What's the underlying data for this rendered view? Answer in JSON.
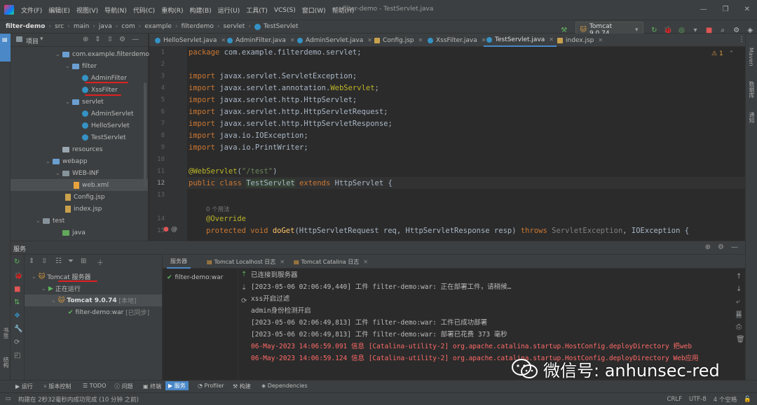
{
  "window": {
    "title": "filter-demo - TestServlet.java",
    "menu": [
      "文件(F)",
      "编辑(E)",
      "视图(V)",
      "导航(N)",
      "代码(C)",
      "重构(R)",
      "构建(B)",
      "运行(U)",
      "工具(T)",
      "VCS(S)",
      "窗口(W)",
      "帮助(H)"
    ]
  },
  "breadcrumbs": [
    "filter-demo",
    "src",
    "main",
    "java",
    "com",
    "example",
    "filterdemo",
    "servlet",
    "TestServlet"
  ],
  "run_config": "Tomcat 9.0.74",
  "project": {
    "title": "项目",
    "tree": [
      {
        "label": "com.example.filterdemo",
        "type": "folder"
      },
      {
        "label": "filter",
        "type": "folder"
      },
      {
        "label": "AdminFilter",
        "type": "class"
      },
      {
        "label": "XssFilter",
        "type": "class"
      },
      {
        "label": "servlet",
        "type": "folder"
      },
      {
        "label": "AdminServlet",
        "type": "class"
      },
      {
        "label": "HelloServlet",
        "type": "class"
      },
      {
        "label": "TestServlet",
        "type": "class"
      },
      {
        "label": "resources",
        "type": "folder"
      },
      {
        "label": "webapp",
        "type": "folder"
      },
      {
        "label": "WEB-INF",
        "type": "folder"
      },
      {
        "label": "web.xml",
        "type": "xml"
      },
      {
        "label": "Config.jsp",
        "type": "jsp"
      },
      {
        "label": "index.jsp",
        "type": "jsp"
      },
      {
        "label": "test",
        "type": "folder"
      },
      {
        "label": "java",
        "type": "folder"
      }
    ]
  },
  "editor": {
    "tabs": [
      "HelloServlet.java",
      "AdminFilter.java",
      "AdminServlet.java",
      "Config.jsp",
      "XssFilter.java",
      "TestServlet.java",
      "index.jsp"
    ],
    "active_tab": "TestServlet.java",
    "warnings": "1",
    "line_numbers": [
      "1",
      "2",
      "3",
      "4",
      "5",
      "6",
      "7",
      "8",
      "9",
      "10",
      "11",
      "12",
      "13",
      "14",
      "15"
    ],
    "usage_hint": "0 个用法",
    "code": {
      "l1_kw": "package",
      "l1_rest": " com.example.filterdemo.servlet;",
      "l3_kw": "import",
      "l3_rest": " javax.servlet.ServletException;",
      "l4_kw": "import",
      "l4_rest": " javax.servlet.annotation.",
      "l4_ann": "WebServlet",
      "l4_end": ";",
      "l5_kw": "import",
      "l5_rest": " javax.servlet.http.HttpServlet;",
      "l6_kw": "import",
      "l6_rest": " javax.servlet.http.HttpServletRequest;",
      "l7_kw": "import",
      "l7_rest": " javax.servlet.http.HttpServletResponse;",
      "l8_kw": "import",
      "l8_rest": " java.io.IOException;",
      "l9_kw": "import",
      "l9_rest": " java.io.PrintWriter;",
      "l11_ann": "@WebServlet",
      "l11_open": "(",
      "l11_str": "\"/test\"",
      "l11_close": ")",
      "l12_kw1": "public class",
      "l12_name": "TestServlet",
      "l12_kw2": "extends",
      "l12_rest": " HttpServlet {",
      "l14_ann": "@Override",
      "l15_kw": "protected void",
      "l15_fn": "doGet",
      "l15_args": "(HttpServletRequest req, HttpServletResponse resp) ",
      "l15_throws": "throws",
      "l15_ex1": " ServletException",
      "l15_end": ", IOException {"
    }
  },
  "services": {
    "title": "服务",
    "tree": {
      "root": "Tomcat 服务器",
      "running": "正在运行",
      "server": "Tomcat 9.0.74",
      "server_tag": "[本地]",
      "artifact": "filter-demo:war",
      "artifact_tag": "[已同步]"
    },
    "log_tabs": [
      "服务器",
      "Tomcat Localhost 日志",
      "Tomcat Catalina 日志"
    ],
    "deployment": "filter-demo:war",
    "log_lines": [
      {
        "text": "已连接到服务器",
        "red": false
      },
      {
        "text": "[2023-05-06 02:06:49,440] 工件 filter-demo:war: 正在部署工件，请稍候…",
        "red": false
      },
      {
        "text": "xss开启过滤",
        "red": false
      },
      {
        "text": "admin身份检测开启",
        "red": false
      },
      {
        "text": "[2023-05-06 02:06:49,813] 工件 filter-demo:war: 工件已成功部署",
        "red": false
      },
      {
        "text": "[2023-05-06 02:06:49,813] 工件 filter-demo:war: 部署已花费 373 毫秒",
        "red": false
      },
      {
        "text": "06-May-2023 14:06:59.091 信息 [Catalina-utility-2] org.apache.catalina.startup.HostConfig.deployDirectory 把web",
        "red": true
      },
      {
        "text": "06-May-2023 14:06:59.124 信息 [Catalina-utility-2] org.apache.catalina.startup.HostConfig.deployDirectory Web应用",
        "red": true
      }
    ]
  },
  "bottom_tools": [
    "运行",
    "版本控制",
    "TODO",
    "问题",
    "终端",
    "服务",
    "Profiler",
    "构建",
    "Dependencies"
  ],
  "status": {
    "message": "构建在 2秒32毫秒内成功完成 (10 分钟 之前)",
    "line_sep": "CRLF",
    "encoding": "UTF-8",
    "indent": "4 个空格"
  },
  "watermark": "微信号: anhunsec-red",
  "stripe_labels": {
    "maven": "Maven",
    "database": "数据库",
    "notifications": "通知",
    "bookmarks": "书签",
    "structure": "结构"
  }
}
